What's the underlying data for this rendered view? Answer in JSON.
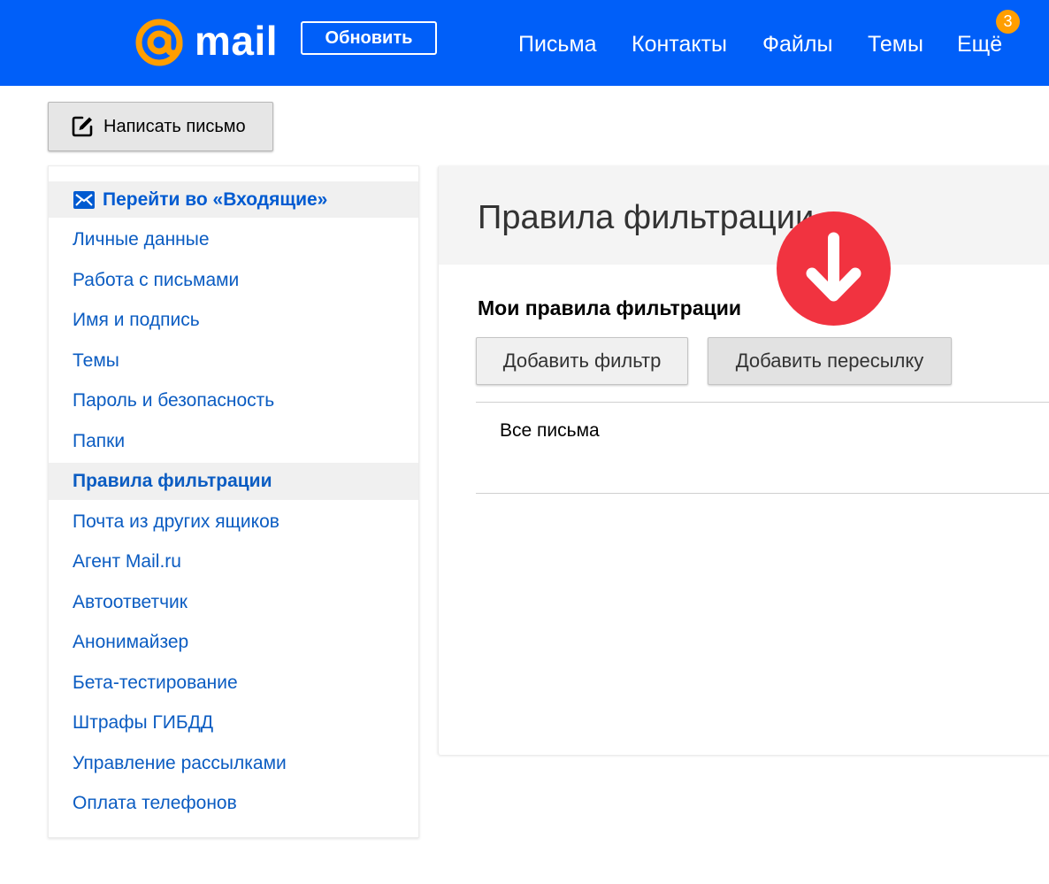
{
  "header": {
    "logo_text": "mail",
    "update_button": "Обновить",
    "nav": [
      "Письма",
      "Контакты",
      "Файлы",
      "Темы",
      "Ещё"
    ],
    "nav_badge": "3",
    "bg_color": "#005ff9",
    "badge_color": "#ff9e00",
    "logo_accent": "#ff9e00"
  },
  "compose": {
    "label": "Написать письмо",
    "icon": "edit-icon"
  },
  "sidebar": {
    "inbox_link": "Перейти во «Входящие»",
    "inbox_icon": "envelope-icon",
    "items": [
      "Личные данные",
      "Работа с письмами",
      "Имя и подпись",
      "Темы",
      "Пароль и безопасность",
      "Папки",
      "Правила фильтрации",
      "Почта из других ящиков",
      "Агент Mail.ru",
      "Автоответчик",
      "Анонимайзер",
      "Бета-тестирование",
      "Штрафы ГИБДД",
      "Управление рассылками",
      "Оплата телефонов"
    ],
    "active_item": "Правила фильтрации",
    "link_color": "#0b5cc2"
  },
  "main": {
    "page_title": "Правила фильтрации",
    "section_title": "Мои правила фильтрации",
    "add_filter_button": "Добавить фильтр",
    "add_forward_button": "Добавить пересылку",
    "rules": [
      "Все письма"
    ]
  },
  "marker": {
    "icon": "arrow-down-icon",
    "color": "#f13340"
  }
}
